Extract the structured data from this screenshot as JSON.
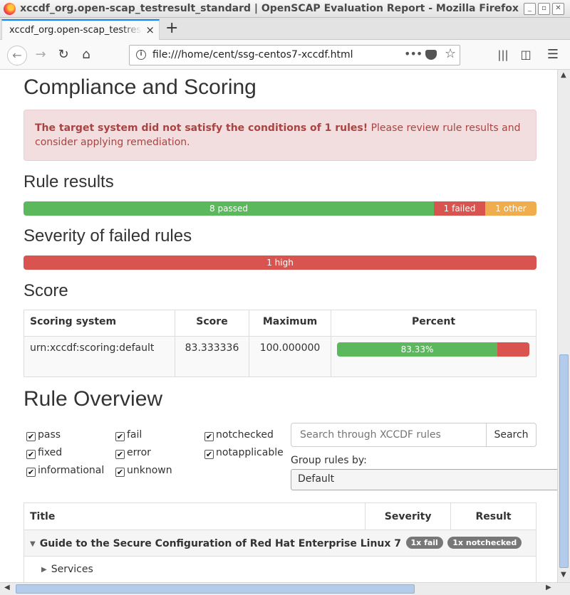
{
  "window": {
    "title": "xccdf_org.open-scap_testresult_standard | OpenSCAP Evaluation Report - Mozilla Firefox"
  },
  "tab": {
    "label": "xccdf_org.open-scap_testresult_standard",
    "close": "×",
    "new_tab": "+"
  },
  "nav": {
    "url": "file:///home/cent/ssg-centos7-xccdf.html",
    "more": "•••"
  },
  "compliance": {
    "heading": "Compliance and Scoring",
    "alert_bold": "The target system did not satisfy the conditions of 1 rules!",
    "alert_rest": " Please review rule results and consider applying remediation."
  },
  "rule_results": {
    "heading": "Rule results",
    "passed": 8,
    "failed": 1,
    "other": 1,
    "passed_label": "8 passed",
    "failed_label": "1 failed",
    "other_label": "1 other"
  },
  "severity": {
    "heading": "Severity of failed rules",
    "high": 1,
    "high_label": "1 high"
  },
  "score": {
    "heading": "Score",
    "columns": [
      "Scoring system",
      "Score",
      "Maximum",
      "Percent"
    ],
    "row": {
      "system": "urn:xccdf:scoring:default",
      "score": "83.333336",
      "maximum": "100.000000",
      "percent_label": "83.33%",
      "percent": 83.33
    }
  },
  "overview": {
    "heading": "Rule Overview",
    "filters": [
      {
        "label": "pass",
        "checked": true
      },
      {
        "label": "fail",
        "checked": true
      },
      {
        "label": "notchecked",
        "checked": true
      },
      {
        "label": "fixed",
        "checked": true
      },
      {
        "label": "error",
        "checked": true
      },
      {
        "label": "notapplicable",
        "checked": true
      },
      {
        "label": "informational",
        "checked": true
      },
      {
        "label": "unknown",
        "checked": true
      }
    ],
    "search_placeholder": "Search through XCCDF rules",
    "search_button": "Search",
    "group_label": "Group rules by:",
    "group_value": "Default",
    "table": {
      "columns": [
        "Title",
        "Severity",
        "Result"
      ],
      "group_title": "Guide to the Secure Configuration of Red Hat Enterprise Linux 7",
      "badges": [
        "1x fail",
        "1x notchecked"
      ],
      "subgroup": "Services"
    }
  },
  "colors": {
    "pass": "#5cb85c",
    "fail": "#d9534f",
    "other": "#f0ad4e",
    "alert_bg": "#f2dede",
    "alert_text": "#a94442"
  }
}
